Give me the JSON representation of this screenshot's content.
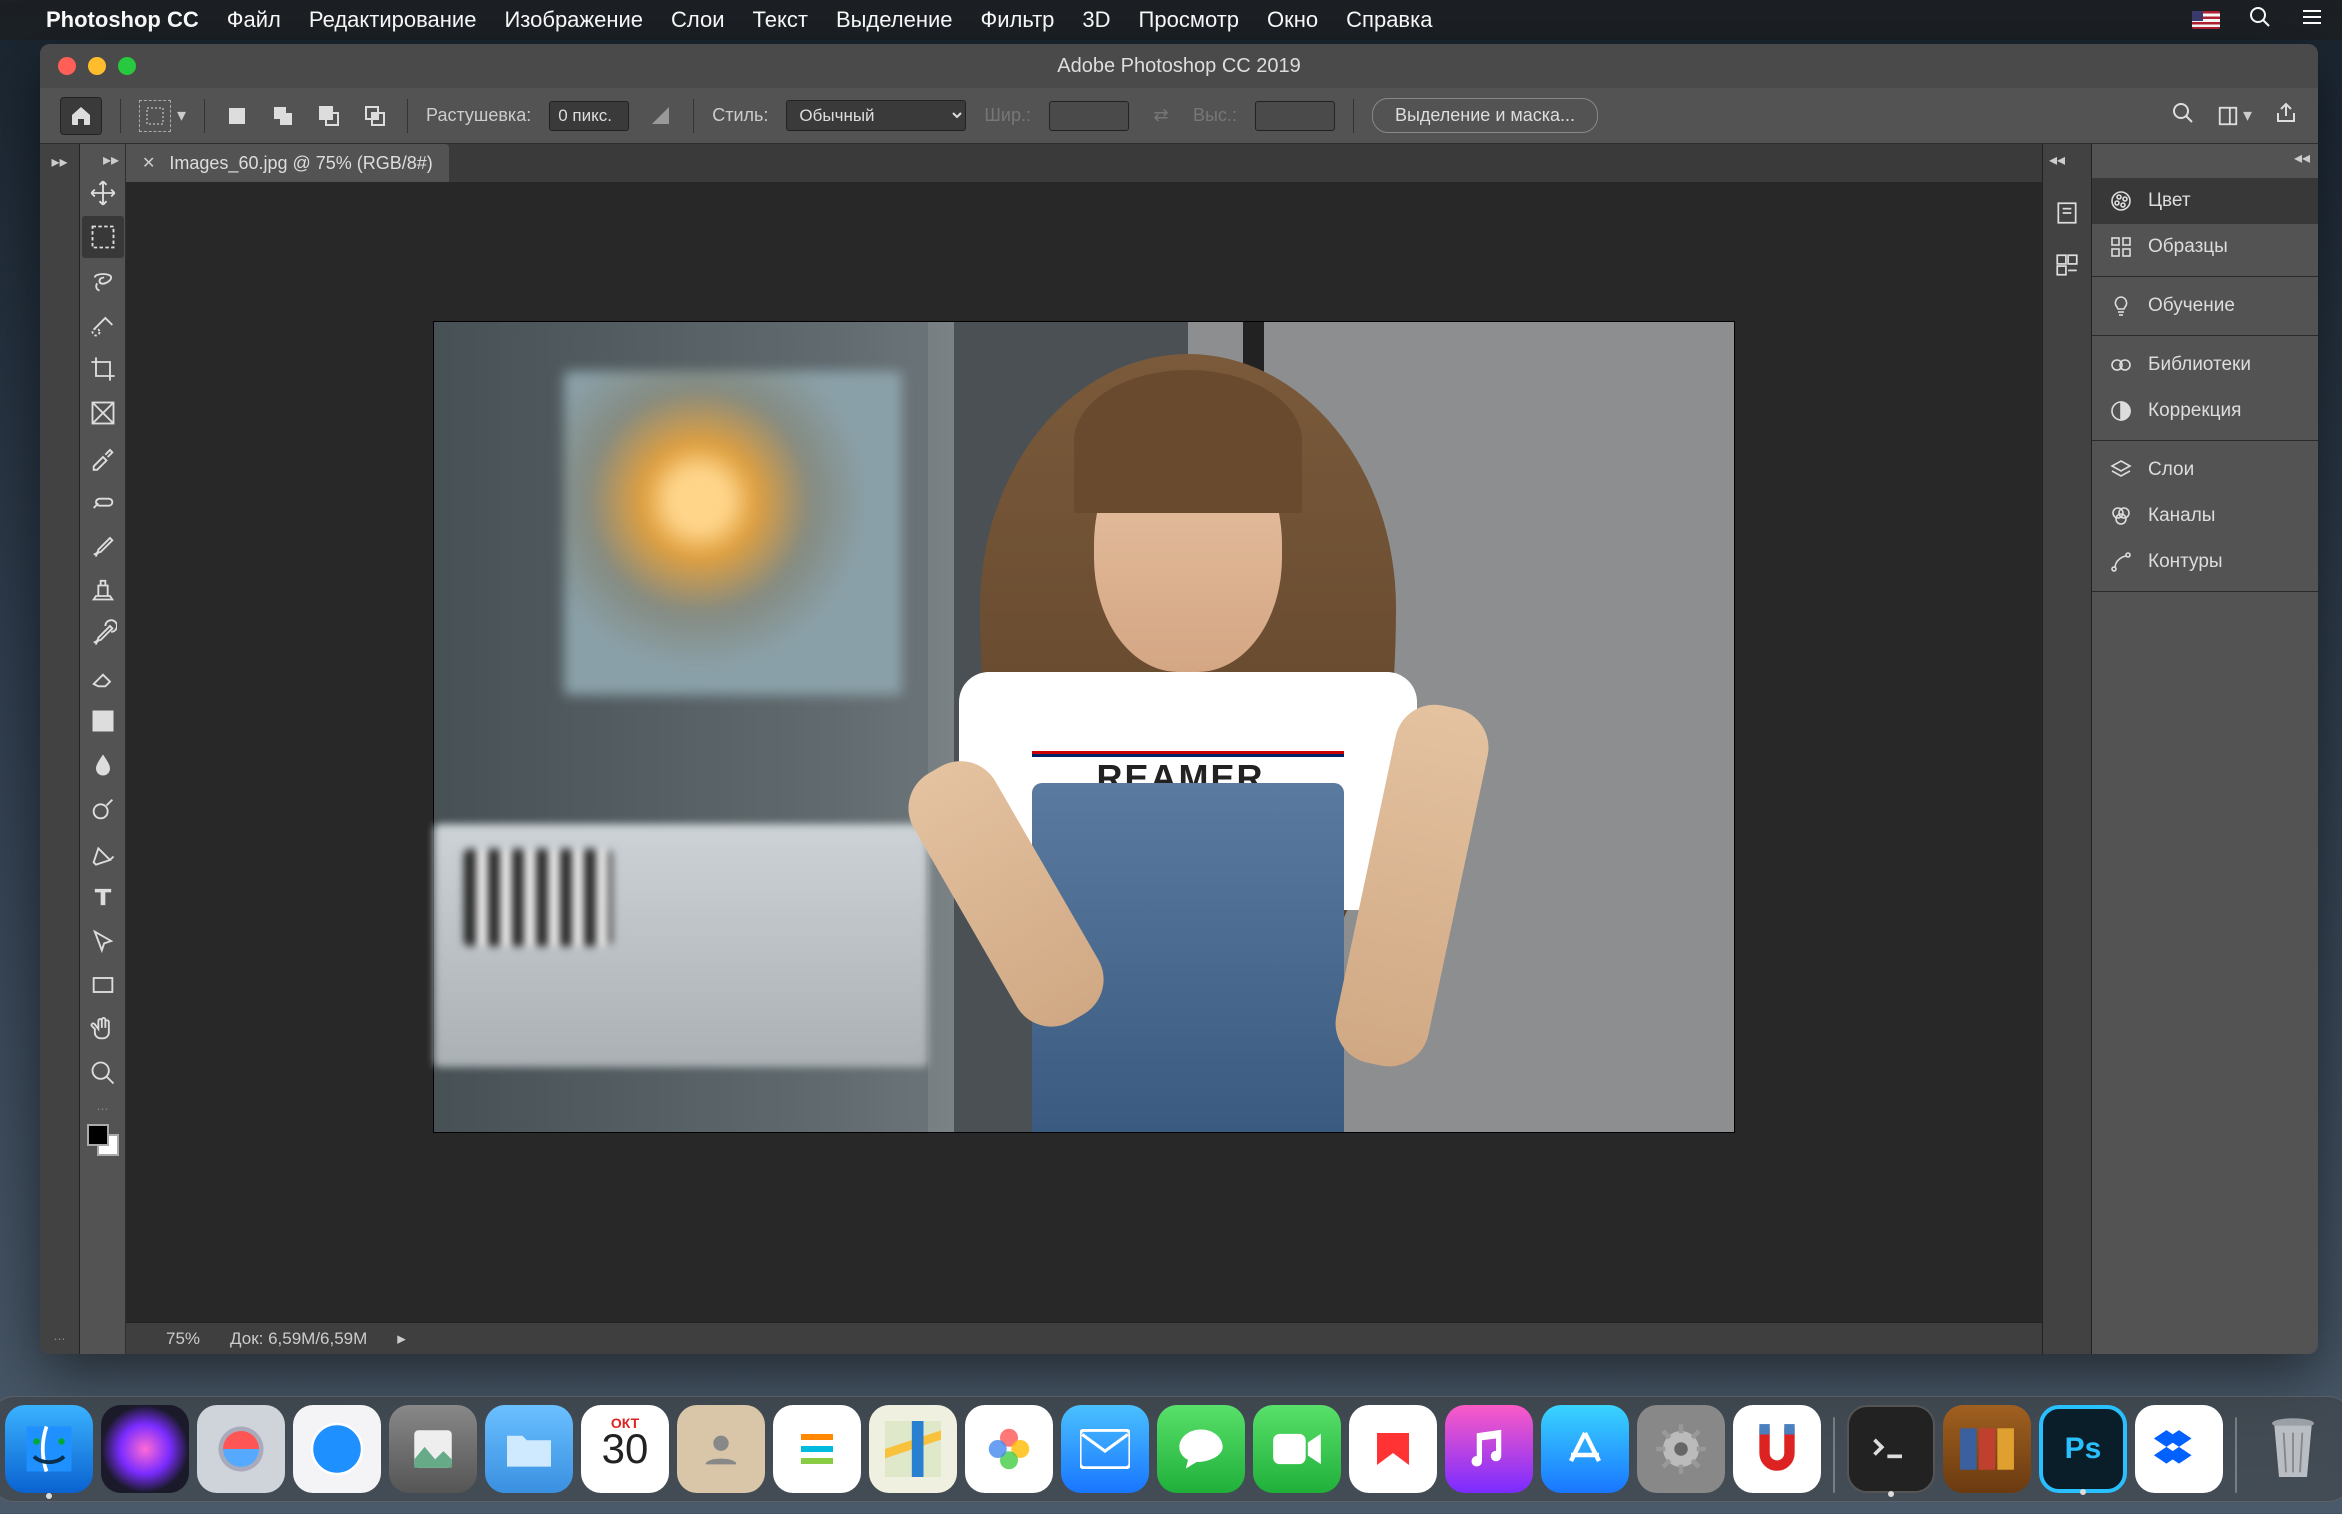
{
  "mac_menu": {
    "app_name": "Photoshop CC",
    "items": [
      "Файл",
      "Редактирование",
      "Изображение",
      "Слои",
      "Текст",
      "Выделение",
      "Фильтр",
      "3D",
      "Просмотр",
      "Окно",
      "Справка"
    ]
  },
  "window": {
    "title": "Adobe Photoshop CC 2019"
  },
  "options_bar": {
    "feather_label": "Растушевка:",
    "feather_value": "0 пикс.",
    "style_label": "Стиль:",
    "style_value": "Обычный",
    "width_label": "Шир.:",
    "height_label": "Выс.:",
    "select_mask_label": "Выделение и маска..."
  },
  "doc_tab": {
    "title": "Images_60.jpg @ 75% (RGB/8#)"
  },
  "status_bar": {
    "zoom": "75%",
    "doc_info": "Док: 6,59M/6,59M"
  },
  "panels": {
    "color": "Цвет",
    "swatches": "Образцы",
    "learn": "Обучение",
    "libraries": "Библиотеки",
    "adjustments": "Коррекция",
    "layers": "Слои",
    "channels": "Каналы",
    "paths": "Контуры"
  },
  "tools": [
    {
      "name": "move-tool"
    },
    {
      "name": "marquee-tool"
    },
    {
      "name": "lasso-tool"
    },
    {
      "name": "quick-select-tool"
    },
    {
      "name": "crop-tool"
    },
    {
      "name": "frame-tool"
    },
    {
      "name": "eyedropper-tool"
    },
    {
      "name": "healing-brush-tool"
    },
    {
      "name": "brush-tool"
    },
    {
      "name": "clone-stamp-tool"
    },
    {
      "name": "history-brush-tool"
    },
    {
      "name": "eraser-tool"
    },
    {
      "name": "gradient-tool"
    },
    {
      "name": "blur-tool"
    },
    {
      "name": "dodge-tool"
    },
    {
      "name": "pen-tool"
    },
    {
      "name": "type-tool"
    },
    {
      "name": "path-select-tool"
    },
    {
      "name": "rectangle-tool"
    },
    {
      "name": "hand-tool"
    },
    {
      "name": "zoom-tool"
    }
  ],
  "dock": {
    "calendar_month": "ОКТ",
    "calendar_day": "30",
    "ps_label": "Ps",
    "items": [
      {
        "name": "finder"
      },
      {
        "name": "siri"
      },
      {
        "name": "launchpad"
      },
      {
        "name": "safari"
      },
      {
        "name": "preview"
      },
      {
        "name": "folder"
      },
      {
        "name": "calendar"
      },
      {
        "name": "contacts"
      },
      {
        "name": "reminders"
      },
      {
        "name": "maps"
      },
      {
        "name": "photos"
      },
      {
        "name": "mail"
      },
      {
        "name": "messages"
      },
      {
        "name": "facetime"
      },
      {
        "name": "news"
      },
      {
        "name": "music"
      },
      {
        "name": "appstore"
      },
      {
        "name": "settings"
      },
      {
        "name": "magnet"
      },
      {
        "name": "terminal"
      },
      {
        "name": "books"
      },
      {
        "name": "photoshop"
      },
      {
        "name": "dropbox"
      },
      {
        "name": "trash"
      }
    ]
  }
}
